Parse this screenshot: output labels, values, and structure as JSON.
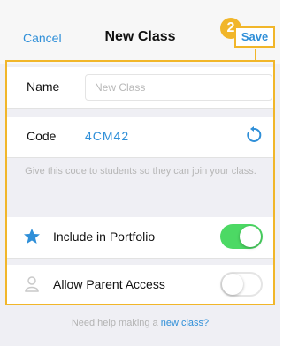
{
  "nav": {
    "cancel_label": "Cancel",
    "title": "New Class",
    "save_label": "Save",
    "step_badge": "2"
  },
  "form": {
    "name": {
      "label": "Name",
      "placeholder": "New Class",
      "value": ""
    },
    "code": {
      "label": "Code",
      "value": "4CM42",
      "refresh_icon": "refresh-icon"
    },
    "hint": "Give this code to students so they can join your class.",
    "portfolio": {
      "label": "Include in Portfolio",
      "icon": "star-icon",
      "enabled": true
    },
    "parent_access": {
      "label": "Allow Parent Access",
      "icon": "parent-icon",
      "enabled": false
    }
  },
  "footer": {
    "prefix": "Need help making a ",
    "link_text": "new class?"
  },
  "colors": {
    "accent": "#2f8fd8",
    "highlight": "#f1b62a",
    "toggle_on": "#4cd964"
  }
}
